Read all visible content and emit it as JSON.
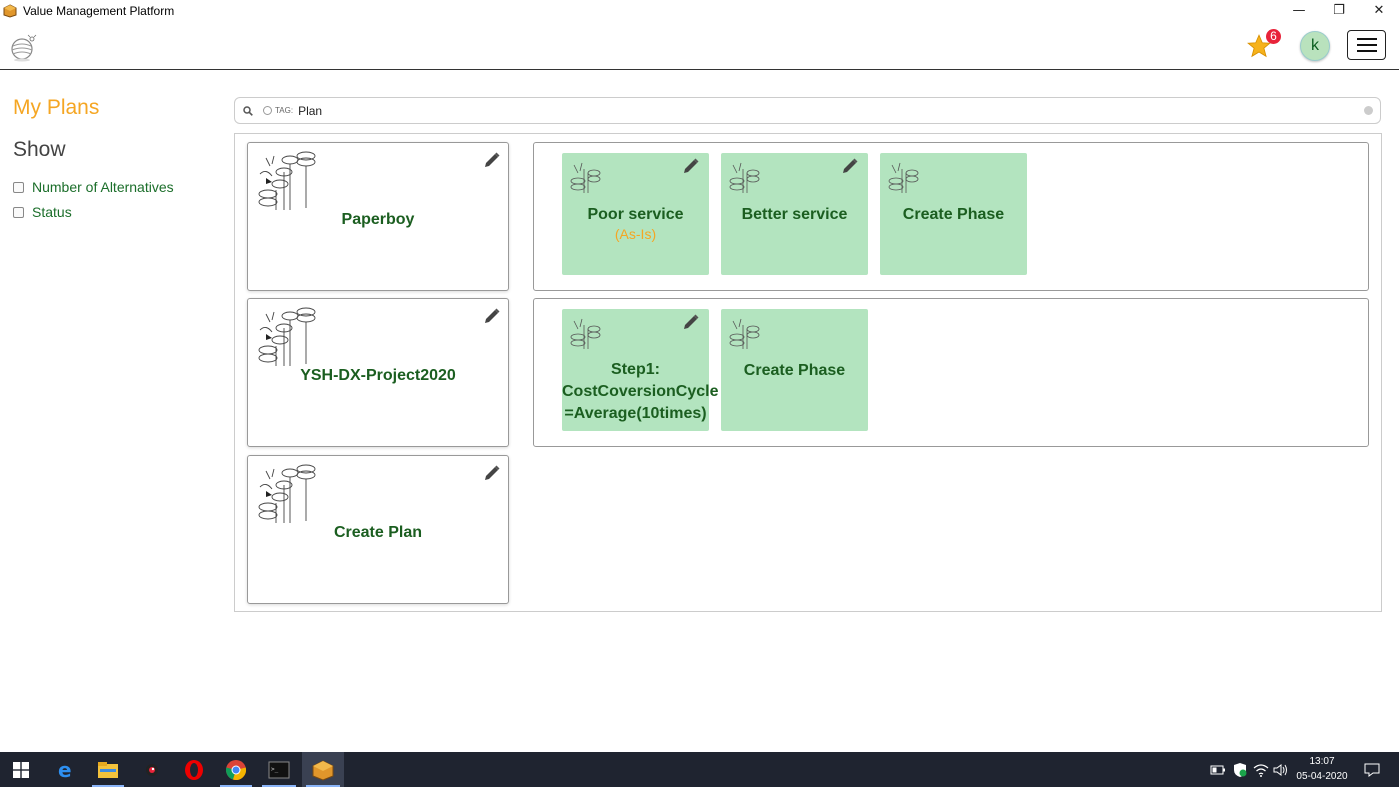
{
  "window": {
    "title": "Value Management Platform",
    "controls": {
      "minimize": "—",
      "restore": "❐",
      "close": "✕"
    }
  },
  "header": {
    "favorites_count": "6",
    "user_initial": "k"
  },
  "sidebar": {
    "title": "My Plans",
    "show_title": "Show",
    "options": [
      {
        "label": "Number of Alternatives",
        "checked": false
      },
      {
        "label": "Status",
        "checked": false
      }
    ]
  },
  "search": {
    "tag_label": "TAG:",
    "tag_value": "Plan"
  },
  "plans": [
    {
      "name": "Paperboy",
      "phases": [
        {
          "name": "Poor service",
          "sub": "(As-Is)",
          "editable": true
        },
        {
          "name": "Better service",
          "sub": "",
          "editable": true
        },
        {
          "name": "Create Phase",
          "sub": "",
          "editable": false
        }
      ]
    },
    {
      "name": "YSH-DX-Project2020",
      "phases": [
        {
          "name": "Step1: CostCoversionCycle =Average(10times)",
          "sub": "",
          "editable": true
        },
        {
          "name": "Create Phase",
          "sub": "",
          "editable": false
        }
      ]
    },
    {
      "name": "Create Plan",
      "phases": []
    }
  ],
  "taskbar": {
    "time": "13:07",
    "date": "05-04-2020"
  },
  "colors": {
    "accent": "#f5a623",
    "green_text": "#1b5e20",
    "phase_bg": "#b3e4bf",
    "badge": "#e8233a"
  }
}
